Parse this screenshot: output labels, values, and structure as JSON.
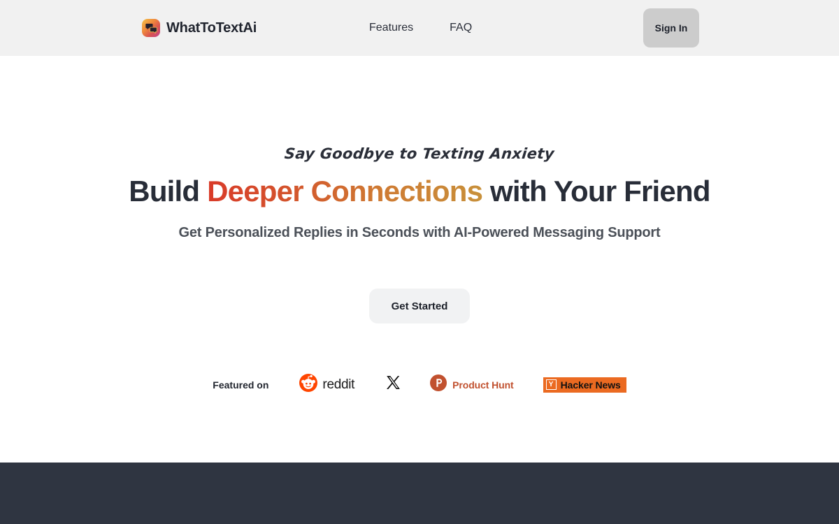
{
  "header": {
    "brand": {
      "name": "WhatToTextAi",
      "icon": "chat-bubbles-icon",
      "gradient_from": "#f2c14a",
      "gradient_to": "#c2418e"
    },
    "nav": [
      {
        "label": "Features"
      },
      {
        "label": "FAQ"
      }
    ],
    "signin_label": "Sign In",
    "background": "#f1f1f1",
    "signin_background": "#cccccc"
  },
  "hero": {
    "eyebrow": "Say Goodbye to Texting Anxiety",
    "headline_pre": "Build ",
    "headline_gradient": "Deeper Connections",
    "headline_post": " with Your Friend",
    "subtitle": "Get Personalized Replies in Seconds with AI-Powered Messaging Support",
    "cta_label": "Get Started",
    "gradient_from": "#d93b29",
    "gradient_to": "#c8903a",
    "heading_color": "#282d38",
    "subtitle_color": "#4b5058"
  },
  "featured": {
    "label": "Featured on",
    "badges": [
      {
        "name": "reddit",
        "label": "reddit",
        "color": "#ff4500"
      },
      {
        "name": "x",
        "label": "X",
        "color": "#000000"
      },
      {
        "name": "product-hunt",
        "label": "Product Hunt",
        "color": "#c1512f",
        "mark": "P"
      },
      {
        "name": "hacker-news",
        "label": "Hacker News",
        "color": "#eb6a21",
        "mark": "Y"
      }
    ]
  },
  "footer": {
    "background": "#2f3541"
  }
}
